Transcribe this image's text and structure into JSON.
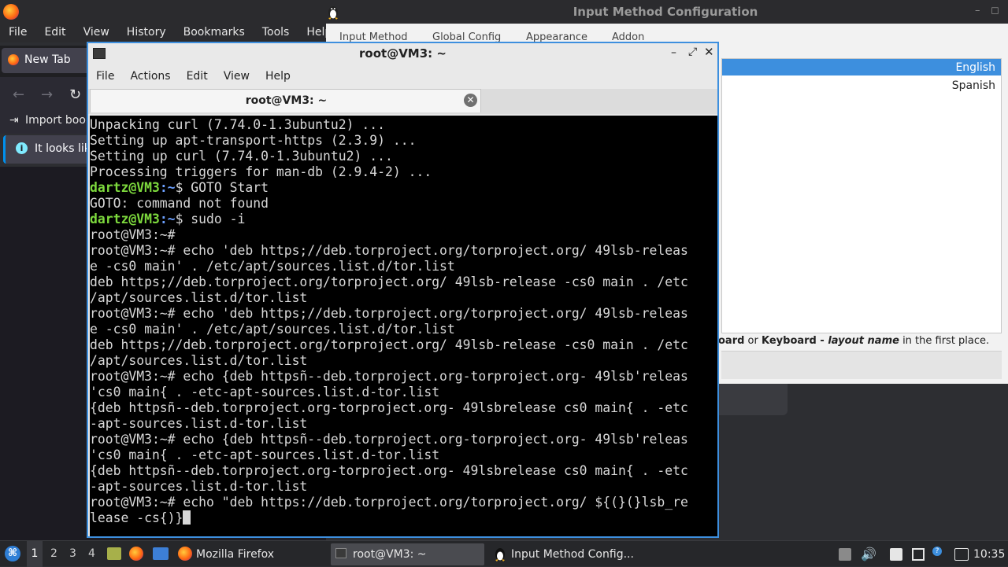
{
  "firefox": {
    "menu": [
      "File",
      "Edit",
      "View",
      "History",
      "Bookmarks",
      "Tools",
      "Help"
    ],
    "tab_title": "New Tab",
    "import_bookmarks": "Import book",
    "notice": "It looks lik"
  },
  "imc": {
    "title": "Input Method Configuration",
    "tabs": [
      "Input Method",
      "Global Config",
      "Appearance",
      "Addon"
    ],
    "languages": [
      "English",
      "Spanish"
    ],
    "hint_pre": "oard",
    "hint_or": " or ",
    "hint_keyboard": "Keyboard - ",
    "hint_layout": "layout name",
    "hint_post": " in the first place."
  },
  "terminal": {
    "title": "root@VM3: ~",
    "menu": [
      "File",
      "Actions",
      "Edit",
      "View",
      "Help"
    ],
    "tab_title": "root@VM3: ~",
    "lines": [
      {
        "t": "Unpacking curl (7.74.0-1.3ubuntu2) ..."
      },
      {
        "t": "Setting up apt-transport-https (2.3.9) ..."
      },
      {
        "t": "Setting up curl (7.74.0-1.3ubuntu2) ..."
      },
      {
        "t": "Processing triggers for man-db (2.9.4-2) ..."
      },
      {
        "u": "dartz@VM3",
        "p": ":~",
        "t": "$ GOTO Start"
      },
      {
        "t": "GOTO: command not found"
      },
      {
        "u": "dartz@VM3",
        "p": ":~",
        "t": "$ sudo -i"
      },
      {
        "t": "root@VM3:~#"
      },
      {
        "t": "root@VM3:~# echo 'deb https;//deb.torproject.org/torproject.org/ 49lsb-releas"
      },
      {
        "t": "e -cs0 main' . /etc/apt/sources.list.d/tor.list"
      },
      {
        "t": "deb https;//deb.torproject.org/torproject.org/ 49lsb-release -cs0 main . /etc"
      },
      {
        "t": "/apt/sources.list.d/tor.list"
      },
      {
        "t": "root@VM3:~# echo 'deb https;//deb.torproject.org/torproject.org/ 49lsb-releas"
      },
      {
        "t": "e -cs0 main' . /etc/apt/sources.list.d/tor.list"
      },
      {
        "t": "deb https;//deb.torproject.org/torproject.org/ 49lsb-release -cs0 main . /etc"
      },
      {
        "t": "/apt/sources.list.d/tor.list"
      },
      {
        "t": "root@VM3:~# echo {deb httpsñ--deb.torproject.org-torproject.org- 49lsb'releas"
      },
      {
        "t": "'cs0 main{ . -etc-apt-sources.list.d-tor.list"
      },
      {
        "t": "{deb httpsñ--deb.torproject.org-torproject.org- 49lsbrelease cs0 main{ . -etc"
      },
      {
        "t": "-apt-sources.list.d-tor.list"
      },
      {
        "t": "root@VM3:~# echo {deb httpsñ--deb.torproject.org-torproject.org- 49lsb'releas"
      },
      {
        "t": "'cs0 main{ . -etc-apt-sources.list.d-tor.list"
      },
      {
        "t": "{deb httpsñ--deb.torproject.org-torproject.org- 49lsbrelease cs0 main{ . -etc"
      },
      {
        "t": "-apt-sources.list.d-tor.list"
      },
      {
        "t": "root@VM3:~# echo \"deb https://deb.torproject.org/torproject.org/ ${(}(}lsb_re"
      },
      {
        "t": "lease -cs{)}",
        "cursor": true
      }
    ]
  },
  "taskbar": {
    "workspaces": [
      "1",
      "2",
      "3",
      "4"
    ],
    "tasks": [
      "Mozilla Firefox",
      "root@VM3: ~",
      "Input Method Config..."
    ],
    "clock": "10:35"
  },
  "colors": {
    "accent": "#3d8fde",
    "prompt_user": "#7dd93d",
    "prompt_path": "#6ca0ff"
  }
}
